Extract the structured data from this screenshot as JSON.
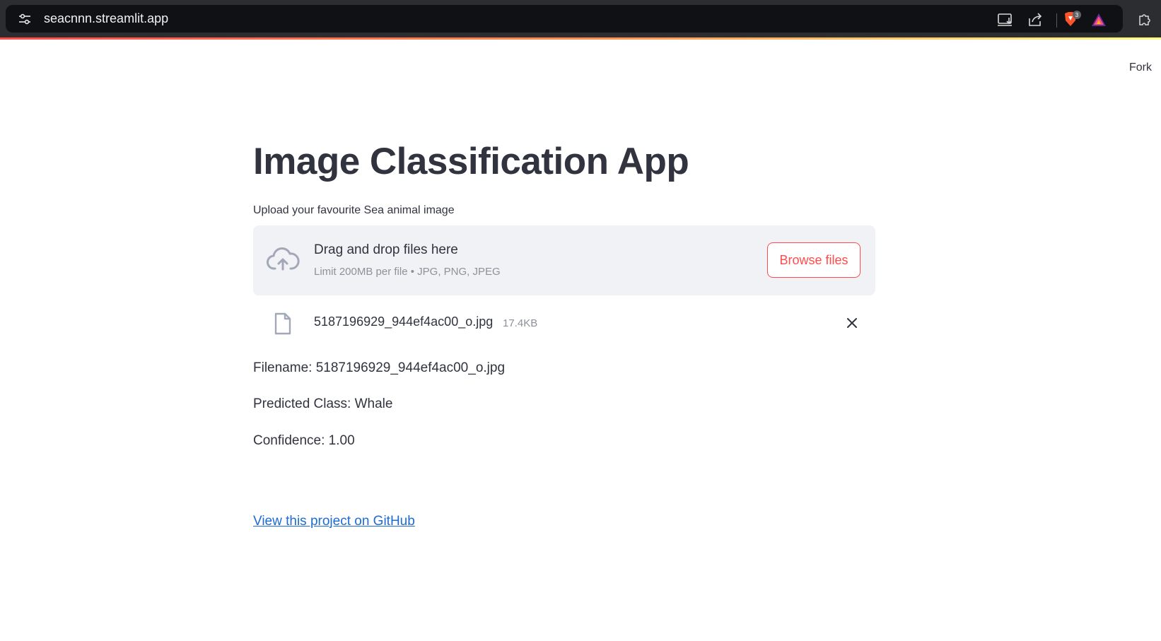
{
  "browser": {
    "url": "seacnnn.streamlit.app",
    "brave_badge_count": "3"
  },
  "header": {
    "fork_label": "Fork"
  },
  "main": {
    "title": "Image Classification App",
    "uploader": {
      "label": "Upload your favourite Sea animal image",
      "drop_title": "Drag and drop files here",
      "drop_limits": "Limit 200MB per file • JPG, PNG, JPEG",
      "browse_label": "Browse files"
    },
    "uploaded_file": {
      "name": "5187196929_944ef4ac00_o.jpg",
      "size": "17.4KB"
    },
    "results": {
      "filename_line": "Filename: 5187196929_944ef4ac00_o.jpg",
      "predicted_line": "Predicted Class: Whale",
      "confidence_line": "Confidence: 1.00"
    },
    "github_link": "View this project on GitHub"
  },
  "colors": {
    "accent": "#ff4b4b",
    "text": "#31333f",
    "muted": "#8e919a",
    "dropzone_bg": "#f0f2f6",
    "link": "#1c6bd6"
  },
  "icons": {
    "site_settings": "tune-icon",
    "install": "install-app-icon",
    "share": "share-icon",
    "brave": "brave-shield-icon",
    "rewards": "brave-rewards-icon",
    "extensions": "puzzle-icon",
    "upload": "cloud-upload-icon",
    "file": "file-icon",
    "remove": "close-icon"
  }
}
